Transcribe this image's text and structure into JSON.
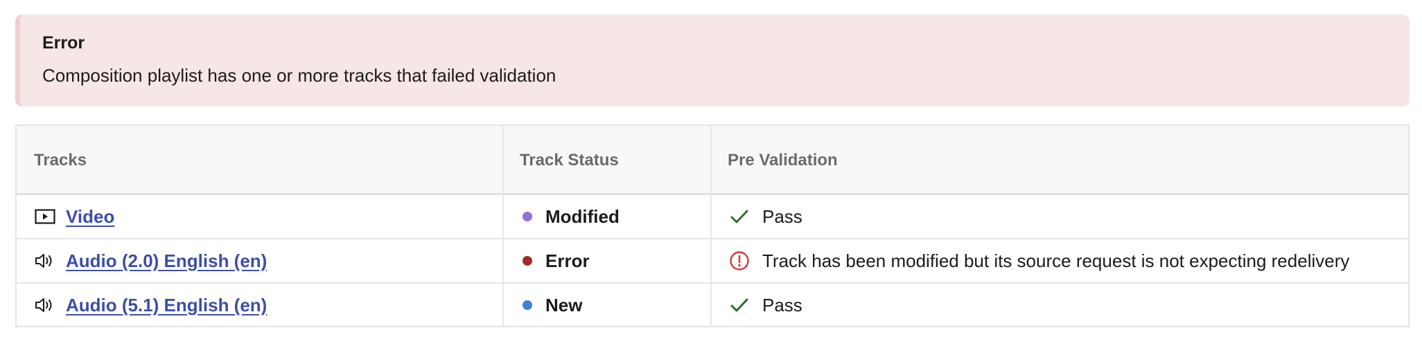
{
  "alert": {
    "title": "Error",
    "message": "Composition playlist has one or more tracks that failed validation"
  },
  "table": {
    "headers": {
      "tracks": "Tracks",
      "status": "Track Status",
      "validation": "Pre Validation"
    },
    "rows": [
      {
        "track": "Video",
        "track_icon": "video-play-icon",
        "status": "Modified",
        "status_color": "#9370DB",
        "validation": "Pass",
        "validation_icon": "check-icon"
      },
      {
        "track": "Audio (2.0) English (en)",
        "track_icon": "speaker-icon",
        "status": "Error",
        "status_color": "#A12A2A",
        "validation": "Track has been modified but its source request is not expecting redelivery",
        "validation_icon": "error-circle-icon"
      },
      {
        "track": "Audio (5.1) English (en)",
        "track_icon": "speaker-icon",
        "status": "New",
        "status_color": "#3B82D6",
        "validation": "Pass",
        "validation_icon": "check-icon"
      }
    ]
  },
  "colors": {
    "alert_bg": "#F7E6E6",
    "link": "#3D4EA8",
    "pass_check": "#2E6B34",
    "error_icon": "#D43A3A"
  }
}
